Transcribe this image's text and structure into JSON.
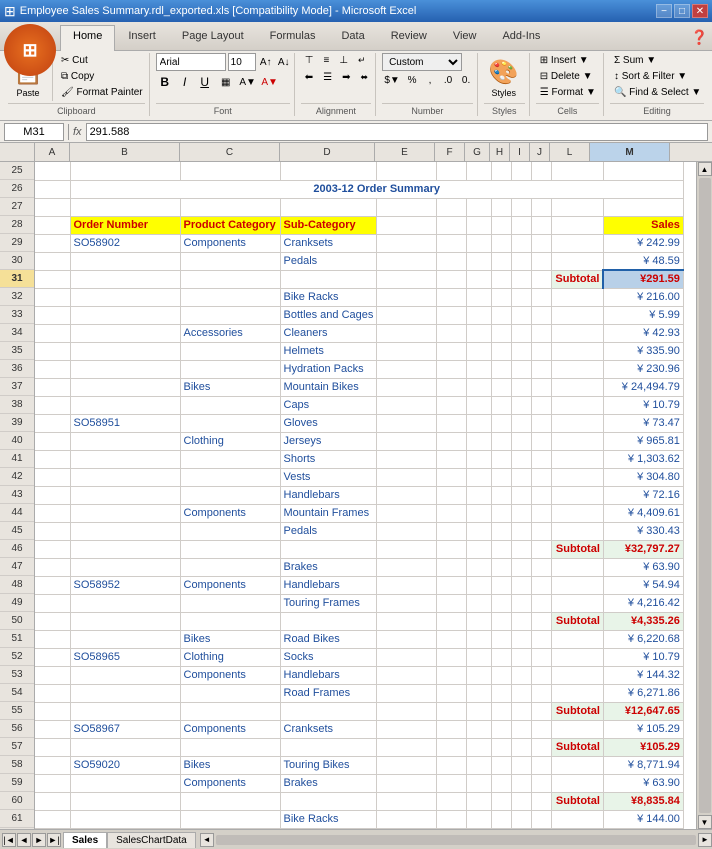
{
  "titleBar": {
    "title": "Employee Sales Summary.rdl_exported.xls [Compatibility Mode] - Microsoft Excel",
    "minBtn": "−",
    "maxBtn": "□",
    "closeBtn": "✕"
  },
  "ribbonTabs": [
    "Home",
    "Insert",
    "Page Layout",
    "Formulas",
    "Data",
    "Review",
    "View",
    "Add-Ins"
  ],
  "activeTab": "Home",
  "ribbon": {
    "groups": {
      "clipboard": "Clipboard",
      "font": "Font",
      "alignment": "Alignment",
      "number": "Number",
      "styles": "Styles",
      "cells": "Cells",
      "editing": "Editing"
    },
    "fontName": "Arial",
    "fontSize": "10",
    "numberFormat": "Custom"
  },
  "formulaBar": {
    "cellRef": "M31",
    "formula": "291.588"
  },
  "columns": {
    "widths": [
      35,
      60,
      120,
      100,
      100,
      90
    ],
    "labels": [
      "",
      "A",
      "B",
      "C",
      "D",
      "E",
      "F",
      "G",
      "H",
      "I",
      "J",
      "L",
      "M"
    ]
  },
  "sheetTitle": "2003-12 Order Summary",
  "headers": {
    "orderNumber": "Order Number",
    "productCategory": "Product Category",
    "subCategory": "Sub-Category",
    "sales": "Sales"
  },
  "rows": [
    {
      "rowNum": 25,
      "type": "empty"
    },
    {
      "rowNum": 26,
      "type": "title"
    },
    {
      "rowNum": 27,
      "type": "empty"
    },
    {
      "rowNum": 28,
      "type": "header"
    },
    {
      "rowNum": 29,
      "order": "SO58902",
      "cat": "Components",
      "subCat": "Cranksets",
      "sales": "¥ 242.99"
    },
    {
      "rowNum": 30,
      "order": "",
      "cat": "",
      "subCat": "Pedals",
      "sales": "¥ 48.59"
    },
    {
      "rowNum": 31,
      "type": "subtotal",
      "sales": "¥291.59",
      "active": true
    },
    {
      "rowNum": 32,
      "order": "",
      "cat": "",
      "subCat": "Bike Racks",
      "sales": "¥ 216.00"
    },
    {
      "rowNum": 33,
      "order": "",
      "cat": "",
      "subCat": "Bottles and Cages",
      "sales": "¥ 5.99"
    },
    {
      "rowNum": 34,
      "order": "",
      "cat": "Accessories",
      "subCat": "Cleaners",
      "sales": "¥ 42.93"
    },
    {
      "rowNum": 35,
      "order": "",
      "cat": "",
      "subCat": "Helmets",
      "sales": "¥ 335.90"
    },
    {
      "rowNum": 36,
      "order": "",
      "cat": "",
      "subCat": "Hydration Packs",
      "sales": "¥ 230.96"
    },
    {
      "rowNum": 37,
      "order": "",
      "cat": "Bikes",
      "subCat": "Mountain Bikes",
      "sales": "¥ 24,494.79"
    },
    {
      "rowNum": 38,
      "order": "",
      "cat": "",
      "subCat": "Caps",
      "sales": "¥ 10.79"
    },
    {
      "rowNum": 39,
      "order": "SO58951",
      "cat": "",
      "subCat": "Gloves",
      "sales": "¥ 73.47"
    },
    {
      "rowNum": 40,
      "order": "",
      "cat": "Clothing",
      "subCat": "Jerseys",
      "sales": "¥ 965.81"
    },
    {
      "rowNum": 41,
      "order": "",
      "cat": "",
      "subCat": "Shorts",
      "sales": "¥ 1,303.62"
    },
    {
      "rowNum": 42,
      "order": "",
      "cat": "",
      "subCat": "Vests",
      "sales": "¥ 304.80"
    },
    {
      "rowNum": 43,
      "order": "",
      "cat": "",
      "subCat": "Handlebars",
      "sales": "¥ 72.16"
    },
    {
      "rowNum": 44,
      "order": "",
      "cat": "Components",
      "subCat": "Mountain Frames",
      "sales": "¥ 4,409.61"
    },
    {
      "rowNum": 45,
      "order": "",
      "cat": "",
      "subCat": "Pedals",
      "sales": "¥ 330.43"
    },
    {
      "rowNum": 46,
      "type": "subtotal",
      "sales": "¥32,797.27"
    },
    {
      "rowNum": 47,
      "order": "",
      "cat": "",
      "subCat": "Brakes",
      "sales": "¥ 63.90"
    },
    {
      "rowNum": 48,
      "order": "SO58952",
      "cat": "Components",
      "subCat": "Handlebars",
      "sales": "¥ 54.94"
    },
    {
      "rowNum": 49,
      "order": "",
      "cat": "",
      "subCat": "Touring Frames",
      "sales": "¥ 4,216.42"
    },
    {
      "rowNum": 50,
      "type": "subtotal",
      "sales": "¥4,335.26"
    },
    {
      "rowNum": 51,
      "order": "",
      "cat": "Bikes",
      "subCat": "Road Bikes",
      "sales": "¥ 6,220.68"
    },
    {
      "rowNum": 52,
      "order": "SO58965",
      "cat": "Clothing",
      "subCat": "Socks",
      "sales": "¥ 10.79"
    },
    {
      "rowNum": 53,
      "order": "",
      "cat": "Components",
      "subCat": "Handlebars",
      "sales": "¥ 144.32"
    },
    {
      "rowNum": 54,
      "order": "",
      "cat": "",
      "subCat": "Road Frames",
      "sales": "¥ 6,271.86"
    },
    {
      "rowNum": 55,
      "type": "subtotal",
      "sales": "¥12,647.65"
    },
    {
      "rowNum": 56,
      "order": "SO58967",
      "cat": "Components",
      "subCat": "Cranksets",
      "sales": "¥ 105.29"
    },
    {
      "rowNum": 57,
      "type": "subtotal",
      "sales": "¥105.29"
    },
    {
      "rowNum": 58,
      "order": "SO59020",
      "cat": "Bikes",
      "subCat": "Touring Bikes",
      "sales": "¥ 8,771.94"
    },
    {
      "rowNum": 59,
      "order": "",
      "cat": "Components",
      "subCat": "Brakes",
      "sales": "¥ 63.90"
    },
    {
      "rowNum": 60,
      "type": "subtotal",
      "sales": "¥8,835.84"
    },
    {
      "rowNum": 61,
      "order": "",
      "cat": "",
      "subCat": "Bike Racks",
      "sales": "¥ 144.00"
    }
  ],
  "sheetTabs": [
    "Sales",
    "SalesChartData"
  ],
  "activeSheet": "Sales"
}
